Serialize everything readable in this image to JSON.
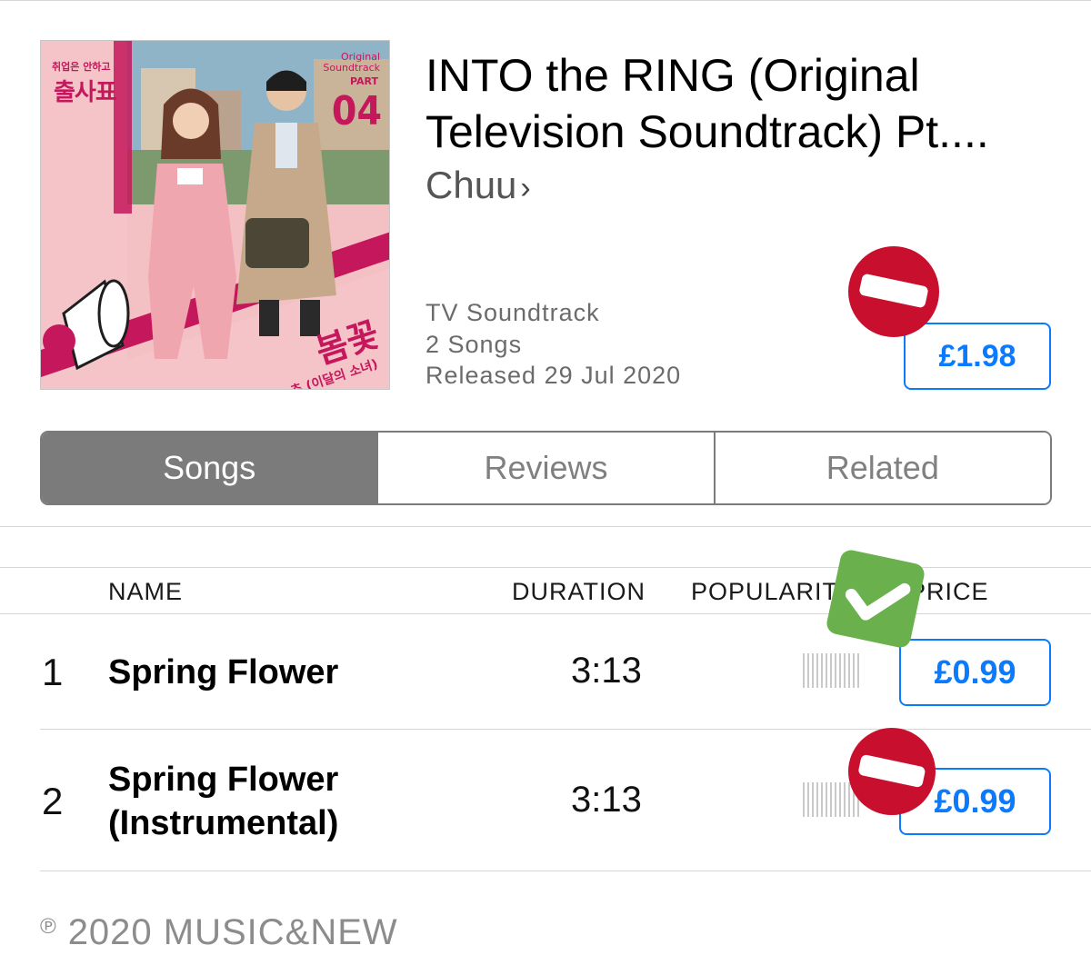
{
  "album": {
    "title": "INTO the RING (Original Television Soundtrack) Pt....",
    "artist": "Chuu",
    "artist_chevron": "›",
    "genre": "TV Soundtrack",
    "song_count": "2 Songs",
    "released": "Released 29 Jul 2020",
    "price": "£1.98",
    "art": {
      "logo_small": "취업은 안하고",
      "logo_big": "출사표",
      "ost_line1": "Original",
      "ost_line2": "Soundtrack",
      "part_label": "PART",
      "part_number": "04",
      "song_title_korean": "봄꽃",
      "artist_korean": "츄 (이달의 소녀)"
    }
  },
  "tabs": [
    {
      "label": "Songs",
      "selected": true
    },
    {
      "label": "Reviews",
      "selected": false
    },
    {
      "label": "Related",
      "selected": false
    }
  ],
  "table": {
    "headers": {
      "name": "NAME",
      "duration": "DURATION",
      "popularity": "POPULARITY",
      "price": "PRICE"
    },
    "rows": [
      {
        "index": "1",
        "name_line1": "Spring Flower",
        "name_line2": "",
        "duration": "3:13",
        "popularity": 0.2,
        "price": "£0.99"
      },
      {
        "index": "2",
        "name_line1": "Spring Flower",
        "name_line2": "(Instrumental)",
        "duration": "3:13",
        "popularity": 0.2,
        "price": "£0.99"
      }
    ]
  },
  "copyright": {
    "symbol": "℗",
    "text": "2020 MUSIC&NEW"
  },
  "overlays": {
    "album_price_badge": "no-entry-icon",
    "row1_badge": "checkmark-icon",
    "row2_badge": "no-entry-icon"
  },
  "colors": {
    "accent": "#0a7aff",
    "segment_selected": "#7b7b7b",
    "no_entry": "#c8102e",
    "check": "#6ab04c"
  }
}
